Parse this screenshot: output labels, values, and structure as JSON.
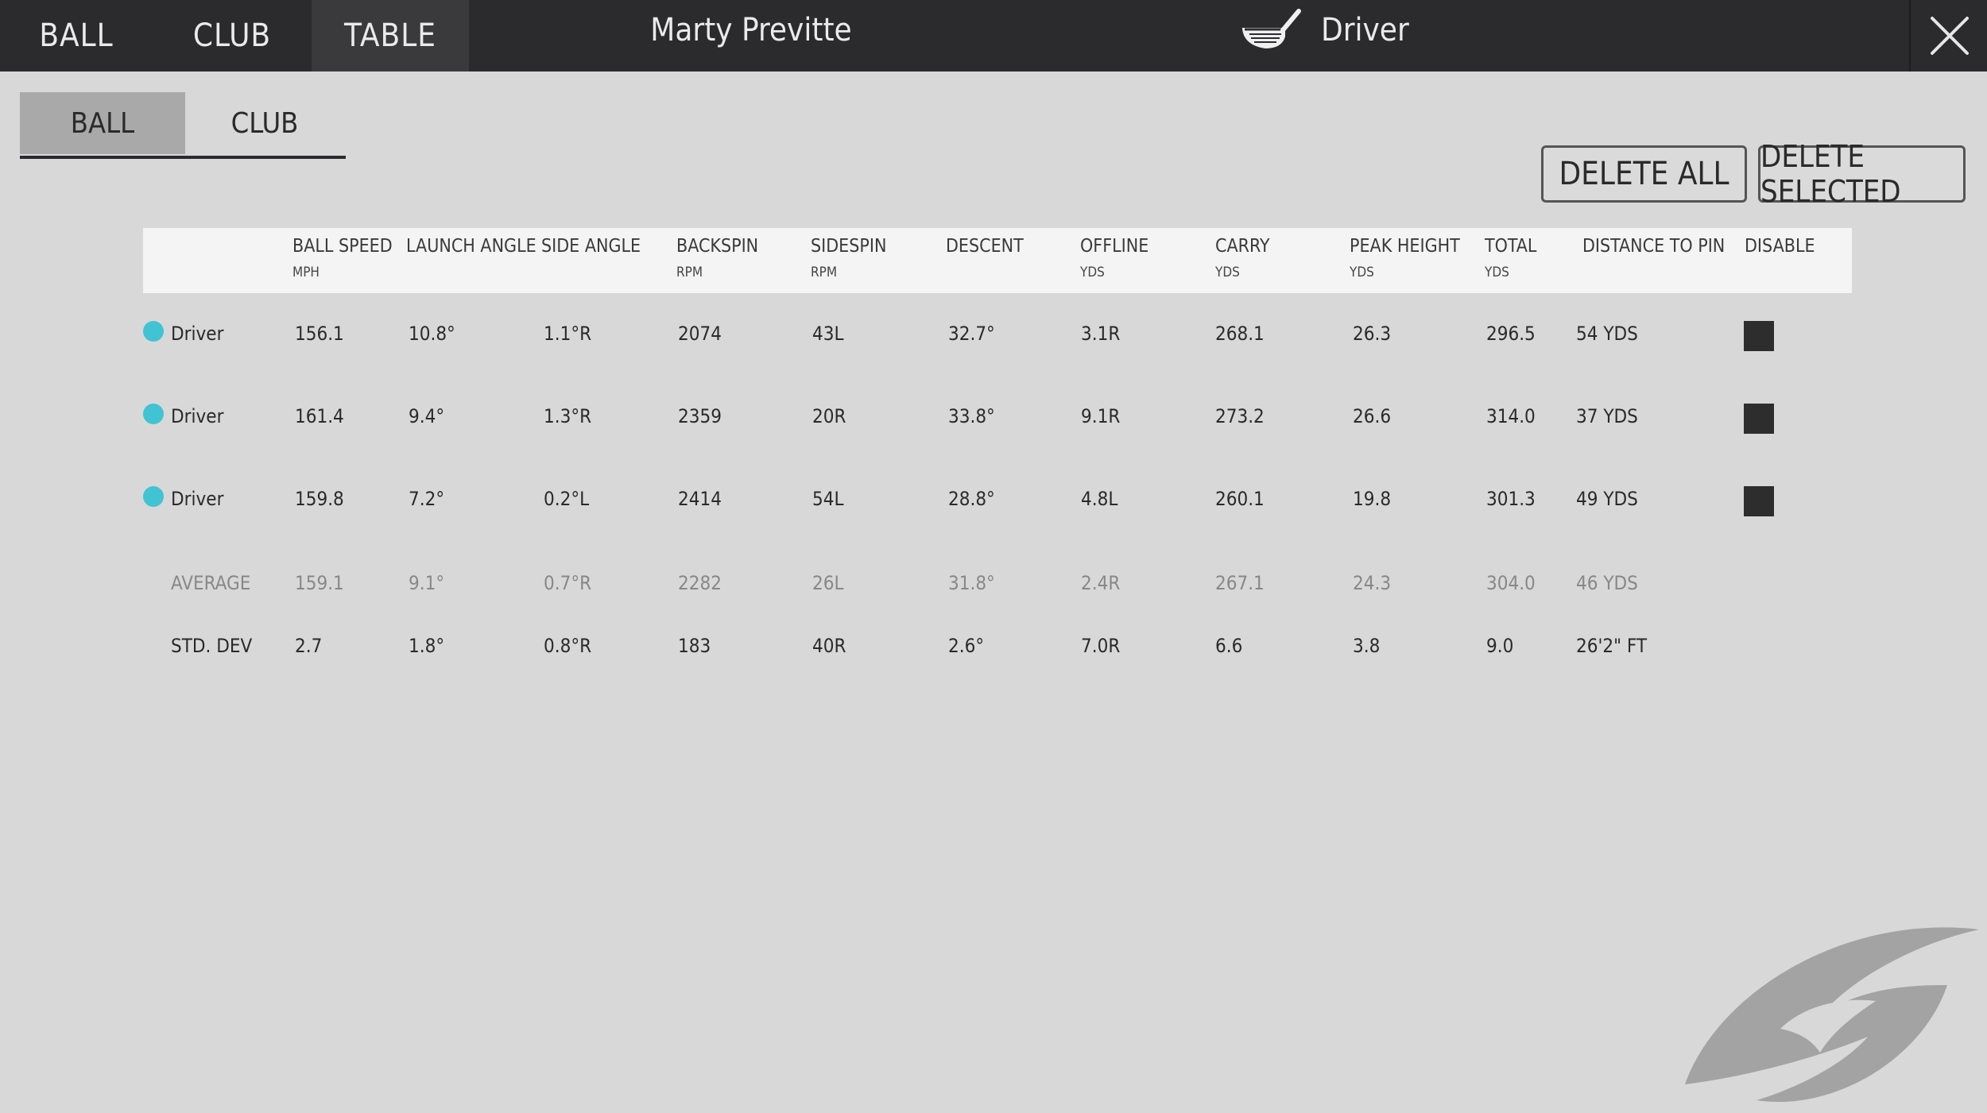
{
  "top_tabs": [
    {
      "label": "BALL",
      "active": false
    },
    {
      "label": "CLUB",
      "active": false
    },
    {
      "label": "TABLE",
      "active": true
    }
  ],
  "player_name": "Marty Previtte",
  "club": {
    "name": "Driver",
    "icon": "driver-club-icon"
  },
  "close_icon": "close-icon",
  "sub_tabs": [
    {
      "label": "BALL",
      "active": true
    },
    {
      "label": "CLUB",
      "active": false
    }
  ],
  "buttons": {
    "delete_all": "DELETE ALL",
    "delete_selected": "DELETE SELECTED"
  },
  "table": {
    "columns": [
      {
        "label": "",
        "unit": ""
      },
      {
        "label": "BALL SPEED",
        "unit": "MPH"
      },
      {
        "label": "LAUNCH ANGLE",
        "unit": ""
      },
      {
        "label": "SIDE ANGLE",
        "unit": ""
      },
      {
        "label": "BACKSPIN",
        "unit": "RPM"
      },
      {
        "label": "SIDESPIN",
        "unit": "RPM"
      },
      {
        "label": "DESCENT",
        "unit": ""
      },
      {
        "label": "OFFLINE",
        "unit": "YDS"
      },
      {
        "label": "CARRY",
        "unit": "YDS"
      },
      {
        "label": "PEAK HEIGHT",
        "unit": "YDS"
      },
      {
        "label": "TOTAL",
        "unit": "YDS"
      },
      {
        "label": "DISTANCE TO PIN",
        "unit": ""
      },
      {
        "label": "DISABLE",
        "unit": ""
      }
    ],
    "rows": [
      {
        "club": "Driver",
        "color": "#41c3d3",
        "values": [
          "156.1",
          "10.8°",
          "1.1°R",
          "2074",
          "43L",
          "32.7°",
          "3.1R",
          "268.1",
          "26.3",
          "296.5",
          "54 YDS"
        ],
        "disabled": true
      },
      {
        "club": "Driver",
        "color": "#41c3d3",
        "values": [
          "161.4",
          "9.4°",
          "1.3°R",
          "2359",
          "20R",
          "33.8°",
          "9.1R",
          "273.2",
          "26.6",
          "314.0",
          "37 YDS"
        ],
        "disabled": true
      },
      {
        "club": "Driver",
        "color": "#41c3d3",
        "values": [
          "159.8",
          "7.2°",
          "0.2°L",
          "2414",
          "54L",
          "28.8°",
          "4.8L",
          "260.1",
          "19.8",
          "301.3",
          "49 YDS"
        ],
        "disabled": true
      }
    ],
    "average": {
      "label": "AVERAGE",
      "values": [
        "159.1",
        "9.1°",
        "0.7°R",
        "2282",
        "26L",
        "31.8°",
        "2.4R",
        "267.1",
        "24.3",
        "304.0",
        "46 YDS"
      ]
    },
    "std_dev": {
      "label": "STD. DEV",
      "values": [
        "2.7",
        "1.8°",
        "0.8°R",
        "183",
        "40R",
        "2.6°",
        "7.0R",
        "6.6",
        "3.8",
        "9.0",
        "26'2\" FT"
      ]
    }
  },
  "watermark_icon": "brand-eye-logo"
}
